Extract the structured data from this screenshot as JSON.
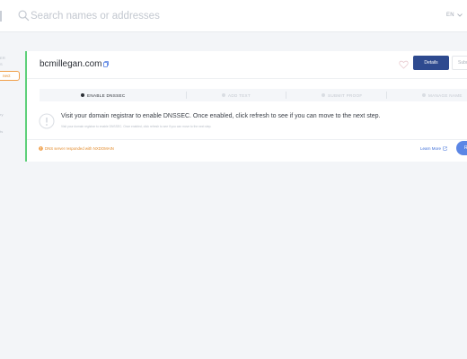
{
  "header": {
    "search_placeholder": "Search names or addresses",
    "language": "EN"
  },
  "sidebar": {
    "label_top_1": "ER",
    "label_top_2": "S",
    "connect_label": "nect",
    "label_mid": "ry",
    "label_low": "ts"
  },
  "domain": {
    "name": "bcmillegan.com",
    "details_label": "Details",
    "subdomains_label": "Subd"
  },
  "steps": [
    {
      "label": "ENABLE DNSSEC",
      "active": true
    },
    {
      "label": "ADD TEXT",
      "active": false
    },
    {
      "label": "SUBMIT PROOF",
      "active": false
    },
    {
      "label": "MANAGE NAME",
      "active": false
    }
  ],
  "message": {
    "main": "Visit your domain registrar to enable DNSSEC. Once enabled, click refresh to see if you can move to the next step.",
    "sub": "Visit your domain registrar to enable DNSSEC. Once enabled, click refresh to see if you can move to the next step."
  },
  "status": {
    "text": "DNS server responded with NXDOMAIN"
  },
  "actions": {
    "learn_more": "Learn More",
    "refresh": "Re"
  },
  "colors": {
    "accent_green": "#5ed07a",
    "primary_blue": "#2e4a8f",
    "button_blue": "#5b86e5",
    "warning_orange": "#e38b2c"
  }
}
